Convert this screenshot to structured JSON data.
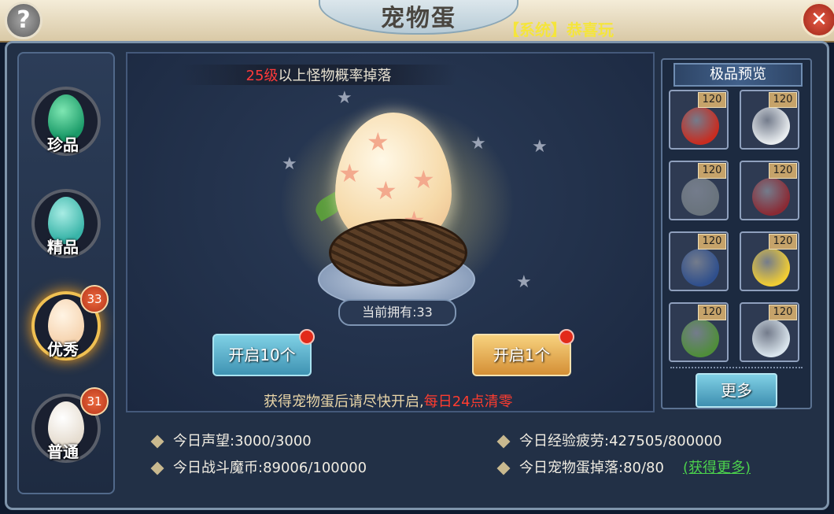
{
  "header": {
    "title": "宠物蛋",
    "system_msg": "【系统】恭喜玩",
    "help_glyph": "?",
    "close_glyph": "✕"
  },
  "sidebar": {
    "items": [
      {
        "label": "珍品",
        "badge": null,
        "egg_color": "#1a9a68",
        "active": false
      },
      {
        "label": "精品",
        "badge": null,
        "egg_color": "#38b4a8",
        "active": false
      },
      {
        "label": "优秀",
        "badge": "33",
        "egg_color": "#f6d4b0",
        "active": true
      },
      {
        "label": "普通",
        "badge": "31",
        "egg_color": "#f3ede3",
        "active": false
      }
    ]
  },
  "main": {
    "subtitle_level": "25级",
    "subtitle_rest": "以上怪物概率掉落",
    "owned": "当前拥有:33",
    "open10": "开启10个",
    "open1": "开启1个",
    "hint_main": "获得宠物蛋后请尽快开启,",
    "hint_red": "每日24点清零"
  },
  "stats": {
    "prestige_label": "今日声望:",
    "prestige_value": "3000/3000",
    "coins_label": "今日战斗魔币:",
    "coins_value": "89006/100000",
    "fatigue_label": "今日经验疲劳:",
    "fatigue_value": "427505/800000",
    "drop_label": "今日宠物蛋掉落:",
    "drop_value": "80/80",
    "get_more": "(获得更多)"
  },
  "preview": {
    "title": "极品预览",
    "more": "更多",
    "slots": [
      {
        "level": "120",
        "color": "#c82c20",
        "icon": "red-beast-icon"
      },
      {
        "level": "120",
        "color": "#e8ecef",
        "icon": "white-wolf-icon"
      },
      {
        "level": "120",
        "color": "#69737c",
        "icon": "stone-dragon-icon"
      },
      {
        "level": "120",
        "color": "#8a2a34",
        "icon": "necklace-icon"
      },
      {
        "level": "120",
        "color": "#2f4f8c",
        "icon": "blue-demon-icon"
      },
      {
        "level": "120",
        "color": "#f1cd34",
        "icon": "yellow-spider-icon"
      },
      {
        "level": "120",
        "color": "#4f8d3a",
        "icon": "cactus-icon"
      },
      {
        "level": "120",
        "color": "#d9e4ec",
        "icon": "sword-icon"
      }
    ]
  },
  "colors": {
    "accent_red": "#ff3a3a",
    "link_green": "#4cd34c",
    "system_yellow": "#f5e53b"
  }
}
